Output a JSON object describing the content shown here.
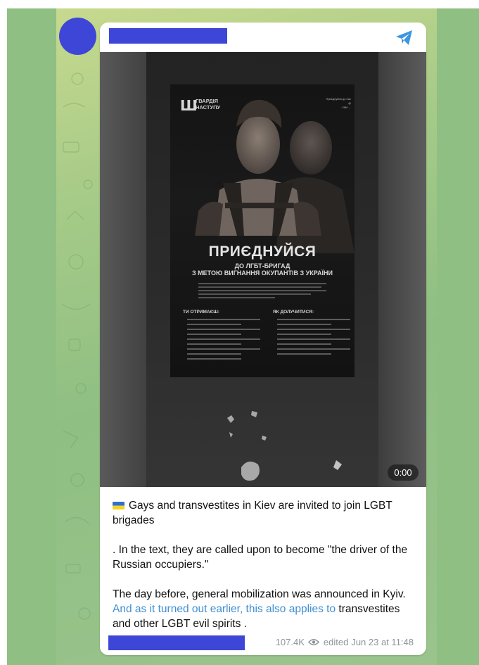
{
  "post": {
    "channel_name": "",
    "video": {
      "duration": "0:00",
      "poster": {
        "logo_text": "ГВАРДІЯ\nНАСТУПУ",
        "contact_text": "Приєднуйся до нас\n@\n+380 ...",
        "headline": "ПРИЄДНУЙСЯ",
        "subheadline_1": "ДО ЛГБТ-БРИГАД",
        "subheadline_2": "З МЕТОЮ ВИГНАННЯ ОКУПАНТІВ З УКРАЇНИ",
        "left_column_title": "ТИ ОТРИМАЄШ:",
        "right_column_title": "ЯК ДОЛУЧИТИСЯ:"
      }
    },
    "caption": {
      "line1": "Gays and transvestites in Kiev are invited to join LGBT brigades",
      "line2": ". In the text, they are called upon to become \"the driver of the Russian occupiers.\"",
      "line3_text": "The day before, general mobilization was announced in Kyiv.",
      "line3_link": "And as it turned out earlier, this also applies to",
      "line3_tail": "transvestites and other LGBT evil spirits ."
    },
    "footer": {
      "views": "107.4K",
      "edited_label": "edited",
      "timestamp": "Jun 23 at 11:48"
    }
  },
  "icons": {
    "share": "telegram-icon",
    "views": "eye-icon",
    "flag": "ukraine-flag-icon"
  },
  "colors": {
    "accent": "#3f8fd2",
    "redaction": "#3e46d8",
    "chat_background": "#8fbf83"
  }
}
